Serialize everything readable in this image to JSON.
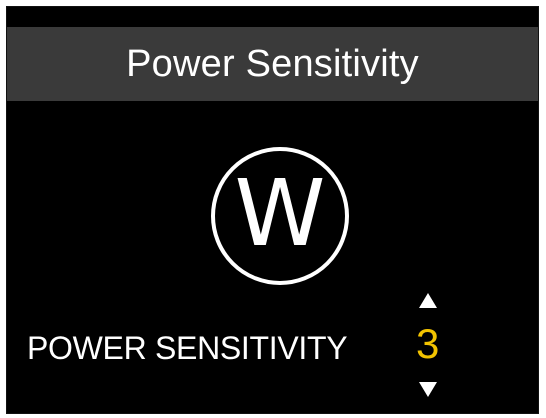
{
  "header": {
    "title": "Power Sensitivity"
  },
  "icon": {
    "name": "power-w-icon",
    "glyph": "W"
  },
  "setting": {
    "label": "POWER SENSITIVITY",
    "value": "3",
    "value_color": "#f2c300"
  },
  "colors": {
    "background": "#000000",
    "title_bar": "#3a3a3a",
    "text": "#ffffff"
  }
}
